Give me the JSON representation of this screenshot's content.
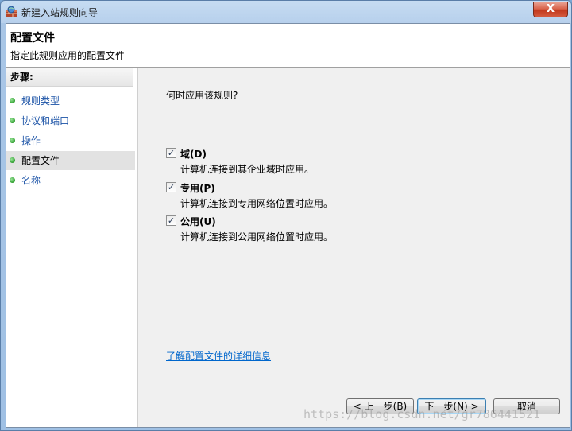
{
  "window": {
    "title": "新建入站规则向导",
    "close_glyph": "X"
  },
  "header": {
    "title": "配置文件",
    "subtitle": "指定此规则应用的配置文件"
  },
  "sidebar": {
    "heading": "步骤:",
    "items": [
      {
        "label": "规则类型",
        "active": false
      },
      {
        "label": "协议和端口",
        "active": false
      },
      {
        "label": "操作",
        "active": false
      },
      {
        "label": "配置文件",
        "active": true
      },
      {
        "label": "名称",
        "active": false
      }
    ]
  },
  "main": {
    "question": "何时应用该规则?",
    "options": [
      {
        "label": "域(D)",
        "description": "计算机连接到其企业域时应用。",
        "checked": true
      },
      {
        "label": "专用(P)",
        "description": "计算机连接到专用网络位置时应用。",
        "checked": true
      },
      {
        "label": "公用(U)",
        "description": "计算机连接到公用网络位置时应用。",
        "checked": true
      }
    ],
    "learn_more": "了解配置文件的详细信息"
  },
  "buttons": {
    "back": "< 上一步(B)",
    "next": "下一步(N) >",
    "cancel": "取消"
  },
  "watermark": "https://blog.csdn.net/gr786441521",
  "colors": {
    "link": "#0066cc",
    "step_dot": "#3aa83a"
  }
}
